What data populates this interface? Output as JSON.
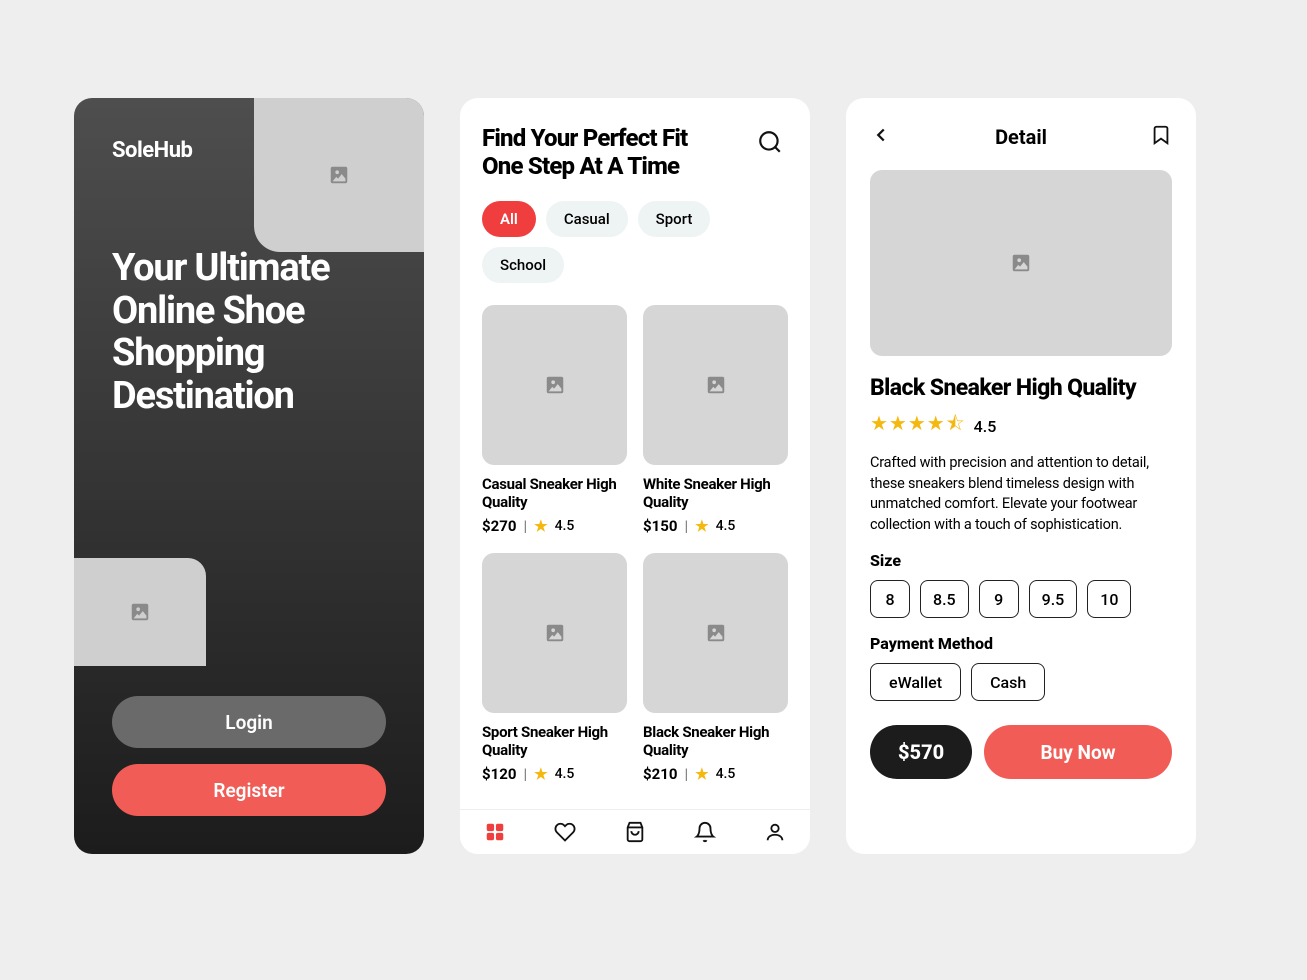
{
  "colors": {
    "accent": "#f15c56",
    "dark": "#1c1c1c",
    "star": "#f4b80e"
  },
  "screen1": {
    "brand": "SoleHub",
    "hero_title": "Your Ultimate Online Shoe Shopping Destination",
    "login_label": "Login",
    "register_label": "Register"
  },
  "screen2": {
    "heading_line1": "Find Your Perfect Fit",
    "heading_line2": "One Step At A Time",
    "chips": [
      "All",
      "Casual",
      "Sport",
      "School"
    ],
    "active_chip": "All",
    "products": [
      {
        "name": "Casual Sneaker High Quality",
        "price": "$270",
        "rating": "4.5"
      },
      {
        "name": "White Sneaker High Quality",
        "price": "$150",
        "rating": "4.5"
      },
      {
        "name": "Sport Sneaker High Quality",
        "price": "$120",
        "rating": "4.5"
      },
      {
        "name": "Black Sneaker High Quality",
        "price": "$210",
        "rating": "4.5"
      }
    ],
    "tabbar_icons": [
      "grid-icon",
      "heart-icon",
      "bag-icon",
      "bell-icon",
      "user-icon"
    ]
  },
  "screen3": {
    "header_title": "Detail",
    "product_name": "Black Sneaker High Quality",
    "rating": "4.5",
    "description": "Crafted with precision and attention to detail, these sneakers blend timeless design with unmatched comfort. Elevate your footwear collection with a touch of sophistication.",
    "size_label": "Size",
    "sizes": [
      "8",
      "8.5",
      "9",
      "9.5",
      "10"
    ],
    "payment_label": "Payment Method",
    "payment_methods": [
      "eWallet",
      "Cash"
    ],
    "total_price": "$570",
    "buy_label": "Buy Now"
  }
}
